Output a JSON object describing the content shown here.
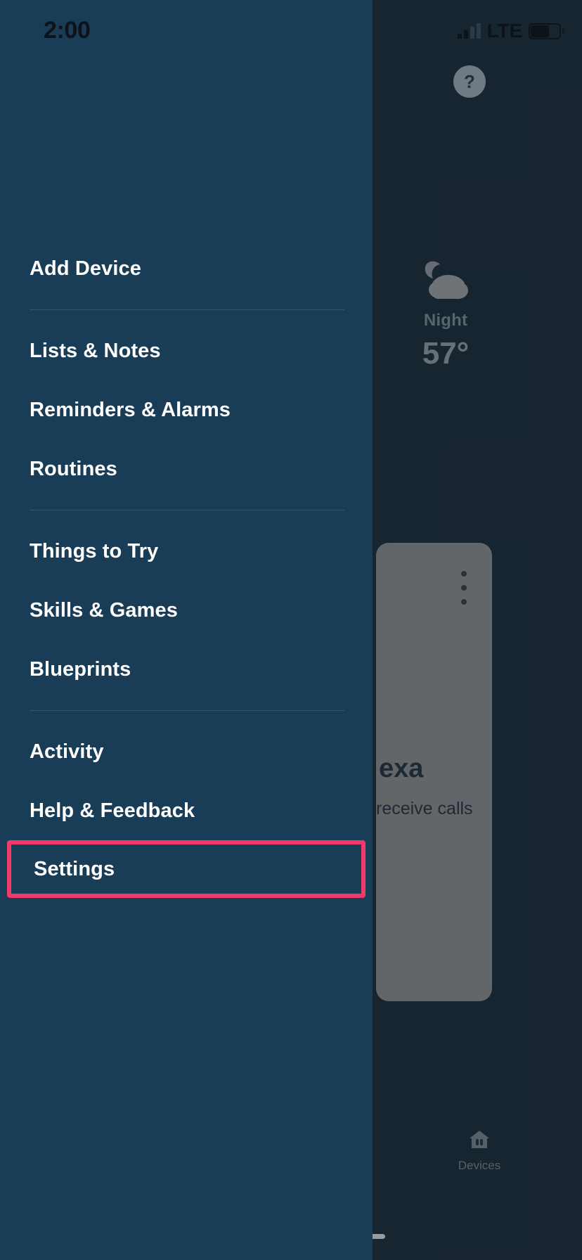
{
  "status_bar": {
    "time": "2:00",
    "network": "LTE",
    "signal_icon": "cellular-signal-icon",
    "battery_icon": "battery-icon"
  },
  "background_app": {
    "help_button": {
      "icon": "question-mark-icon",
      "label": "?"
    },
    "weather": {
      "icon": "moon-cloud-night-icon",
      "condition": "Night",
      "temperature": "57°"
    },
    "card": {
      "kebab_icon": "more-vertical-icon",
      "title": "exa",
      "subtitle": "receive calls"
    },
    "tab_bar": {
      "items": [
        {
          "label": "Devices",
          "icon": "devices-house-icon"
        }
      ]
    },
    "home_indicator": "home-indicator"
  },
  "drawer": {
    "groups": [
      {
        "items": [
          {
            "label": "Add Device",
            "name": "add-device",
            "highlighted": false
          }
        ]
      },
      {
        "items": [
          {
            "label": "Lists & Notes",
            "name": "lists-and-notes",
            "highlighted": false
          },
          {
            "label": "Reminders & Alarms",
            "name": "reminders-and-alarms",
            "highlighted": false
          },
          {
            "label": "Routines",
            "name": "routines",
            "highlighted": false
          }
        ]
      },
      {
        "items": [
          {
            "label": "Things to Try",
            "name": "things-to-try",
            "highlighted": false
          },
          {
            "label": "Skills & Games",
            "name": "skills-and-games",
            "highlighted": false
          },
          {
            "label": "Blueprints",
            "name": "blueprints",
            "highlighted": false
          }
        ]
      },
      {
        "items": [
          {
            "label": "Activity",
            "name": "activity",
            "highlighted": false
          },
          {
            "label": "Help & Feedback",
            "name": "help-and-feedback",
            "highlighted": false
          },
          {
            "label": "Settings",
            "name": "settings",
            "highlighted": true
          }
        ]
      }
    ]
  },
  "colors": {
    "drawer_bg": "#1a3d57",
    "background_dim": "#223342",
    "highlight_border": "#f23a6b",
    "menu_text": "#ffffff",
    "divider": "#32566e",
    "card_bg": "#a3a3a3"
  }
}
